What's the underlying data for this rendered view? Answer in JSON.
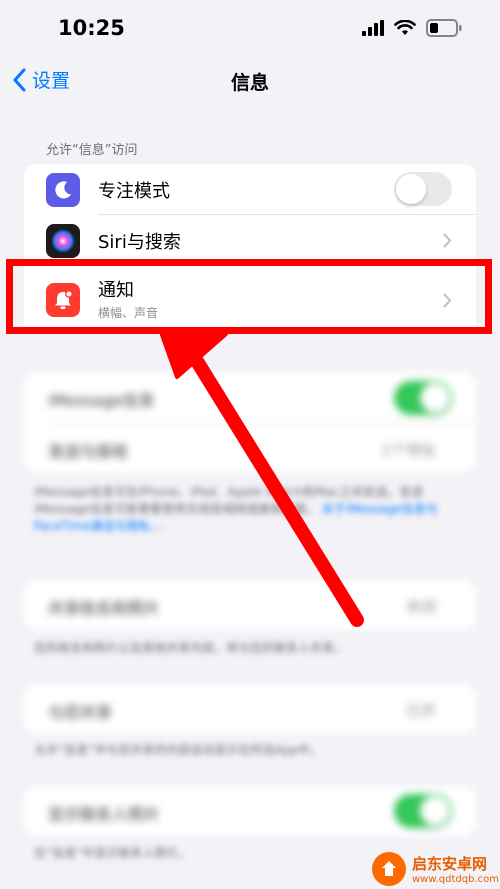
{
  "status_bar": {
    "time": "10:25"
  },
  "nav": {
    "back_label": "设置",
    "title": "信息"
  },
  "section": {
    "header": "允许“信息”访问"
  },
  "rows": [
    {
      "label": "专注模式",
      "icon": "moon-icon",
      "icon_color": "#5e5ce6",
      "toggle_on": false
    },
    {
      "label": "Siri与搜索",
      "icon": "siri-icon",
      "icon_color": "#1c1c1e"
    },
    {
      "label": "通知",
      "sublabel": "横幅、声音",
      "icon": "bell-badge-icon",
      "icon_color": "#ff3b30"
    }
  ],
  "blurred": {
    "group1": [
      {
        "label": "iMessage信息",
        "toggle_on": true
      },
      {
        "label": "发送与接收",
        "value": "2个地址"
      }
    ],
    "footer1": "iMessage信息可在iPhone、iPad、Apple Watch和Mac之间发送。发送iMessage信息可能需要使用无线局域网或蜂窝数据。",
    "footer1_link": "关于iMessage信息与FaceTime通话与隐私…",
    "group2": [
      {
        "label": "共享姓名和照片",
        "value": "关闭"
      }
    ],
    "footer2": "您的姓名和照片以及其他共享内容，将与您的联系人共享。",
    "group3": [
      {
        "label": "与您共享",
        "value": "已开"
      }
    ],
    "footer3": "允许“信息”中与您共享的内容自动显示在所选App中。",
    "group4": [
      {
        "label": "显示联系人照片",
        "toggle_on": true
      }
    ],
    "footer4": "在“信息”中显示联系人照片。"
  },
  "watermark": {
    "title": "启东安卓网",
    "url": "www.qdtdqb.com"
  },
  "colors": {
    "accent": "#007aff",
    "highlight": "#ff0000",
    "toggle_on": "#34c759"
  }
}
